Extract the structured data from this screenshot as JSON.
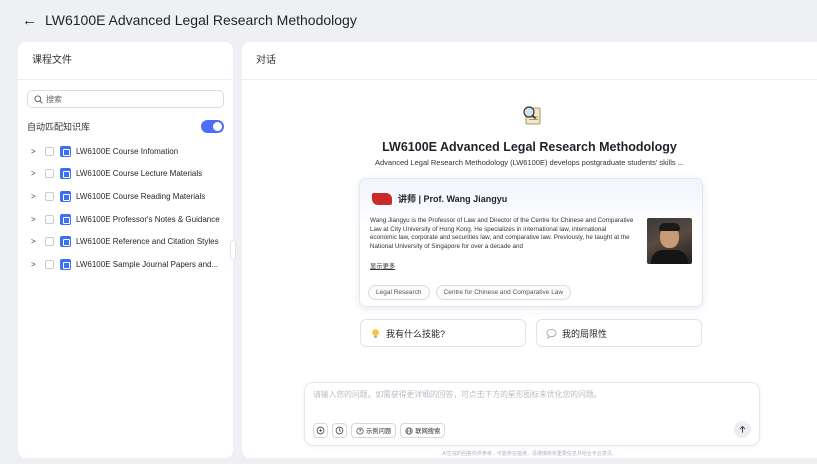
{
  "header": {
    "title": "LW6100E Advanced Legal Research Methodology"
  },
  "left_panel": {
    "title": "课程文件",
    "search_placeholder": "搜索",
    "auto_match_label": "自动匹配知识库",
    "auto_match_enabled": true,
    "files": [
      {
        "label": "LW6100E Course Infomation"
      },
      {
        "label": "LW6100E Course Lecture Materials"
      },
      {
        "label": "LW6100E Course Reading Materials"
      },
      {
        "label": "LW6100E Professor's Notes & Guidance"
      },
      {
        "label": "LW6100E Reference and Citation Styles"
      },
      {
        "label": "LW6100E Sample Journal Papers and..."
      }
    ]
  },
  "chat": {
    "title": "对话",
    "course_title": "LW6100E Advanced Legal Research Methodology",
    "course_description": "Advanced Legal Research Methodology (LW6100E) develops postgraduate students' skills ...",
    "instructor": {
      "name_label": "讲师 | Prof. Wang Jiangyu",
      "bio": "Wang Jiangyu is the Professor of Law and Director of the Centre for Chinese and Comparative Law at City University of Hong Kong. He specializes in international law, international economic law, corporate and securities law, and comparative law. Previously, he taught at the National University of Singapore for over a decade and",
      "show_more": "显示更多",
      "tags": [
        "Legal Research",
        "Centre for Chinese and Comparative Law"
      ]
    },
    "quick_actions": [
      {
        "label": "我有什么技能?",
        "icon": "lightbulb-icon"
      },
      {
        "label": "我的局限性",
        "icon": "speech-bubble-icon"
      }
    ],
    "composer": {
      "placeholder": "请输入您的问题。如需获得更详细的回答，可点击下方的星形图标来优化您的问题。",
      "tools": [
        {
          "label": "",
          "icon": "enhance-icon"
        },
        {
          "label": "",
          "icon": "history-icon"
        },
        {
          "label": "示例问题",
          "icon": "question-icon"
        },
        {
          "label": "联网搜索",
          "icon": "globe-icon"
        }
      ],
      "send_icon": "arrow-up-icon"
    },
    "disclaimer": "AI生成的回答仅供参考，可能存在错误，请谨慎核实重要信息并结合专业意见。"
  },
  "colors": {
    "accent": "#4f6ef7",
    "file_icon": "#3b6ff5",
    "logo_red": "#c92a2a"
  }
}
